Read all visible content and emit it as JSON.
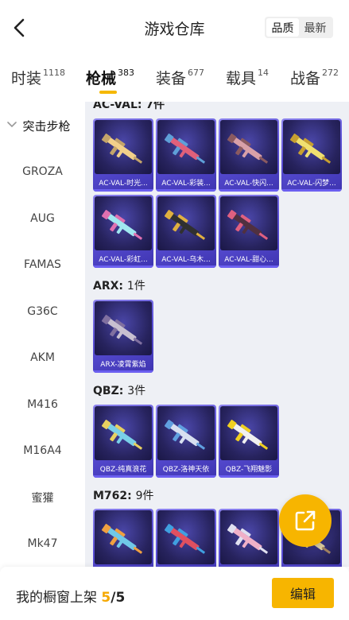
{
  "header": {
    "title": "游戏仓库",
    "sort_options": [
      "品质",
      "最新"
    ],
    "sort_active": "品质"
  },
  "tabs": [
    {
      "label": "时装",
      "count": "1118"
    },
    {
      "label": "枪械",
      "count": "383",
      "active": true
    },
    {
      "label": "装备",
      "count": "677"
    },
    {
      "label": "载具",
      "count": "14"
    },
    {
      "label": "战备",
      "count": "272"
    }
  ],
  "sidebar": {
    "items": [
      "突击步枪",
      "GROZA",
      "AUG",
      "FAMAS",
      "G36C",
      "AKM",
      "M416",
      "M16A4",
      "蜜獾",
      "Mk47"
    ],
    "active": "突击步枪"
  },
  "sections": [
    {
      "name": "AC-VAL",
      "count": "7件",
      "items": [
        {
          "label": "AC-VAL-时光...",
          "gun_color": "#f2d08a",
          "accent": "#c4a46a"
        },
        {
          "label": "AC-VAL-彩装...",
          "gun_color": "#e0607a",
          "accent": "#5fa0d8"
        },
        {
          "label": "AC-VAL-快闪...",
          "gun_color": "#d8a0a8",
          "accent": "#8a5a60"
        },
        {
          "label": "AC-VAL-闪梦...",
          "gun_color": "#f0e070",
          "accent": "#c8a030"
        },
        {
          "label": "AC-VAL-彩虹...",
          "gun_color": "#a0e8f0",
          "accent": "#e070b0"
        },
        {
          "label": "AC-VAL-乌木...",
          "gun_color": "#303030",
          "accent": "#e0b040"
        },
        {
          "label": "AC-VAL-甜心...",
          "gun_color": "#503040",
          "accent": "#e06080"
        }
      ]
    },
    {
      "name": "ARX",
      "count": "1件",
      "items": [
        {
          "label": "ARX-凌霄紫焰",
          "gun_color": "#c8c0d0",
          "accent": "#8070a0"
        }
      ]
    },
    {
      "name": "QBZ",
      "count": "3件",
      "items": [
        {
          "label": "QBZ-纯真浪花",
          "gun_color": "#7ad0e8",
          "accent": "#e8d060"
        },
        {
          "label": "QBZ-洛神天依",
          "gun_color": "#d8e0f0",
          "accent": "#60a0e0"
        },
        {
          "label": "QBZ-飞翔魅影",
          "gun_color": "#f0f0f0",
          "accent": "#f0d020"
        }
      ]
    },
    {
      "name": "M762",
      "count": "9件",
      "items": [
        {
          "label": "",
          "gun_color": "#70c8e8",
          "accent": "#f0a040"
        },
        {
          "label": "",
          "gun_color": "#e05060",
          "accent": "#40a0e0"
        },
        {
          "label": "",
          "gun_color": "#f0b0c8",
          "accent": "#e0e0f0"
        },
        {
          "label": "",
          "gun_color": "#e0d0a0",
          "accent": "#a08060"
        }
      ]
    }
  ],
  "first_section_title_partial": "AC-VAL: 7件",
  "showcase": {
    "label": "我的橱窗上架",
    "current": "5",
    "separator": "/",
    "max": "5"
  },
  "edit_label": "编辑",
  "icons": {
    "back": "chevron-left-icon",
    "sidebar_expand": "chevron-down-icon",
    "fab": "share-export-icon"
  }
}
